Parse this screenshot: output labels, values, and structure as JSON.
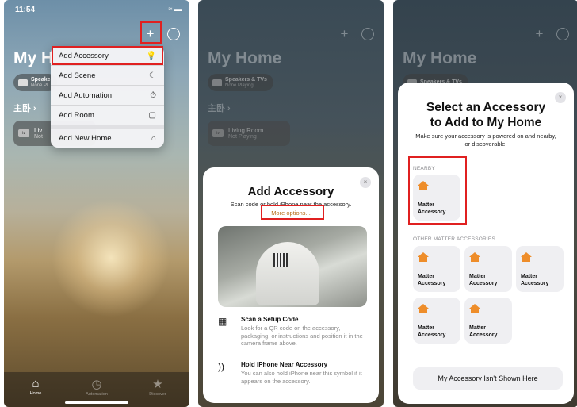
{
  "screen1": {
    "status": {
      "time": "11:54",
      "icons": "≈ ▬"
    },
    "plus_icon": "+",
    "more_icon": "···",
    "home_title": "My H",
    "pill": {
      "title": "Speake",
      "subtitle": "None Pl"
    },
    "room": {
      "header": "主卧 ›",
      "tile_title": "Liv",
      "tile_subtitle": "Not",
      "tv_badge": "tv"
    },
    "menu": [
      {
        "label": "Add Accessory",
        "icon": "💡"
      },
      {
        "label": "Add Scene",
        "icon": "☾"
      },
      {
        "label": "Add Automation",
        "icon": "⏱"
      },
      {
        "label": "Add Room",
        "icon": "▢"
      },
      {
        "label": "Add New Home",
        "icon": "⌂"
      }
    ],
    "tabs": [
      {
        "label": "Home",
        "icon": "⌂"
      },
      {
        "label": "Automation",
        "icon": "◷"
      },
      {
        "label": "Discover",
        "icon": "★"
      }
    ]
  },
  "screen2": {
    "plus_icon": "+",
    "more_icon": "···",
    "home_title": "My Home",
    "pill": {
      "title": "Speakers & TVs",
      "subtitle": "None Playing"
    },
    "room": {
      "header": "主卧 ›",
      "tile_title": "Living Room",
      "tile_subtitle": "Not Playing",
      "tv_badge": "tv"
    },
    "sheet": {
      "close": "×",
      "title": "Add Accessory",
      "subtitle": "Scan code or hold iPhone near the accessory.",
      "link": "More options...",
      "tips": [
        {
          "icon": "▦",
          "title": "Scan a Setup Code",
          "body": "Look for a QR code on the accessory, packaging, or instructions and position it in the camera frame above."
        },
        {
          "icon": "))",
          "title": "Hold iPhone Near Accessory",
          "body": "You can also hold iPhone near this symbol if it appears on the accessory."
        }
      ]
    }
  },
  "screen3": {
    "plus_icon": "+",
    "more_icon": "···",
    "home_title": "My Home",
    "pill": {
      "title": "Speakers & TVs",
      "subtitle": ""
    },
    "sheet": {
      "close": "×",
      "title": "Select an Accessory to Add to My Home",
      "subtitle": "Make sure your accessory is powered on and nearby, or discoverable.",
      "nearby_label": "NEARBY",
      "nearby": [
        {
          "label": "Matter Accessory"
        }
      ],
      "other_label": "OTHER MATTER ACCESSORIES",
      "others": [
        {
          "label": "Matter Accessory"
        },
        {
          "label": "Matter Accessory"
        },
        {
          "label": "Matter Accessory"
        },
        {
          "label": "Matter Accessory"
        },
        {
          "label": "Matter Accessory"
        }
      ],
      "not_shown_button": "My Accessory Isn't Shown Here"
    }
  },
  "colors": {
    "highlight": "#e02020",
    "accent": "#ee8d2a",
    "link": "#b8701b"
  }
}
